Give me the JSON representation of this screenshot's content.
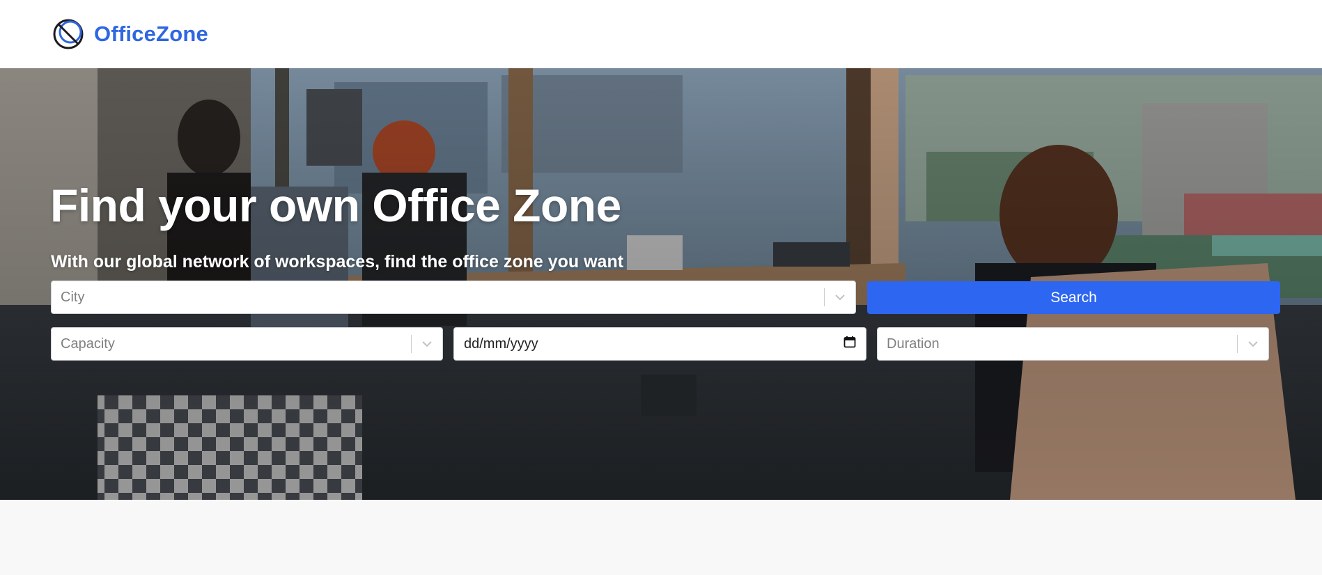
{
  "brand": {
    "name": "OfficeZone",
    "color": "#2f66e2",
    "icon": "officezone-logo-icon"
  },
  "hero": {
    "title": "Find your own Office Zone",
    "subtitle": "With our global network of workspaces, find the office zone you want",
    "background": "office-coworking-photo"
  },
  "search": {
    "city_placeholder": "City",
    "capacity_placeholder": "Capacity",
    "date_placeholder": "dd/mm/yyyy",
    "duration_placeholder": "Duration",
    "button_label": "Search",
    "button_color": "#2d66f0"
  }
}
